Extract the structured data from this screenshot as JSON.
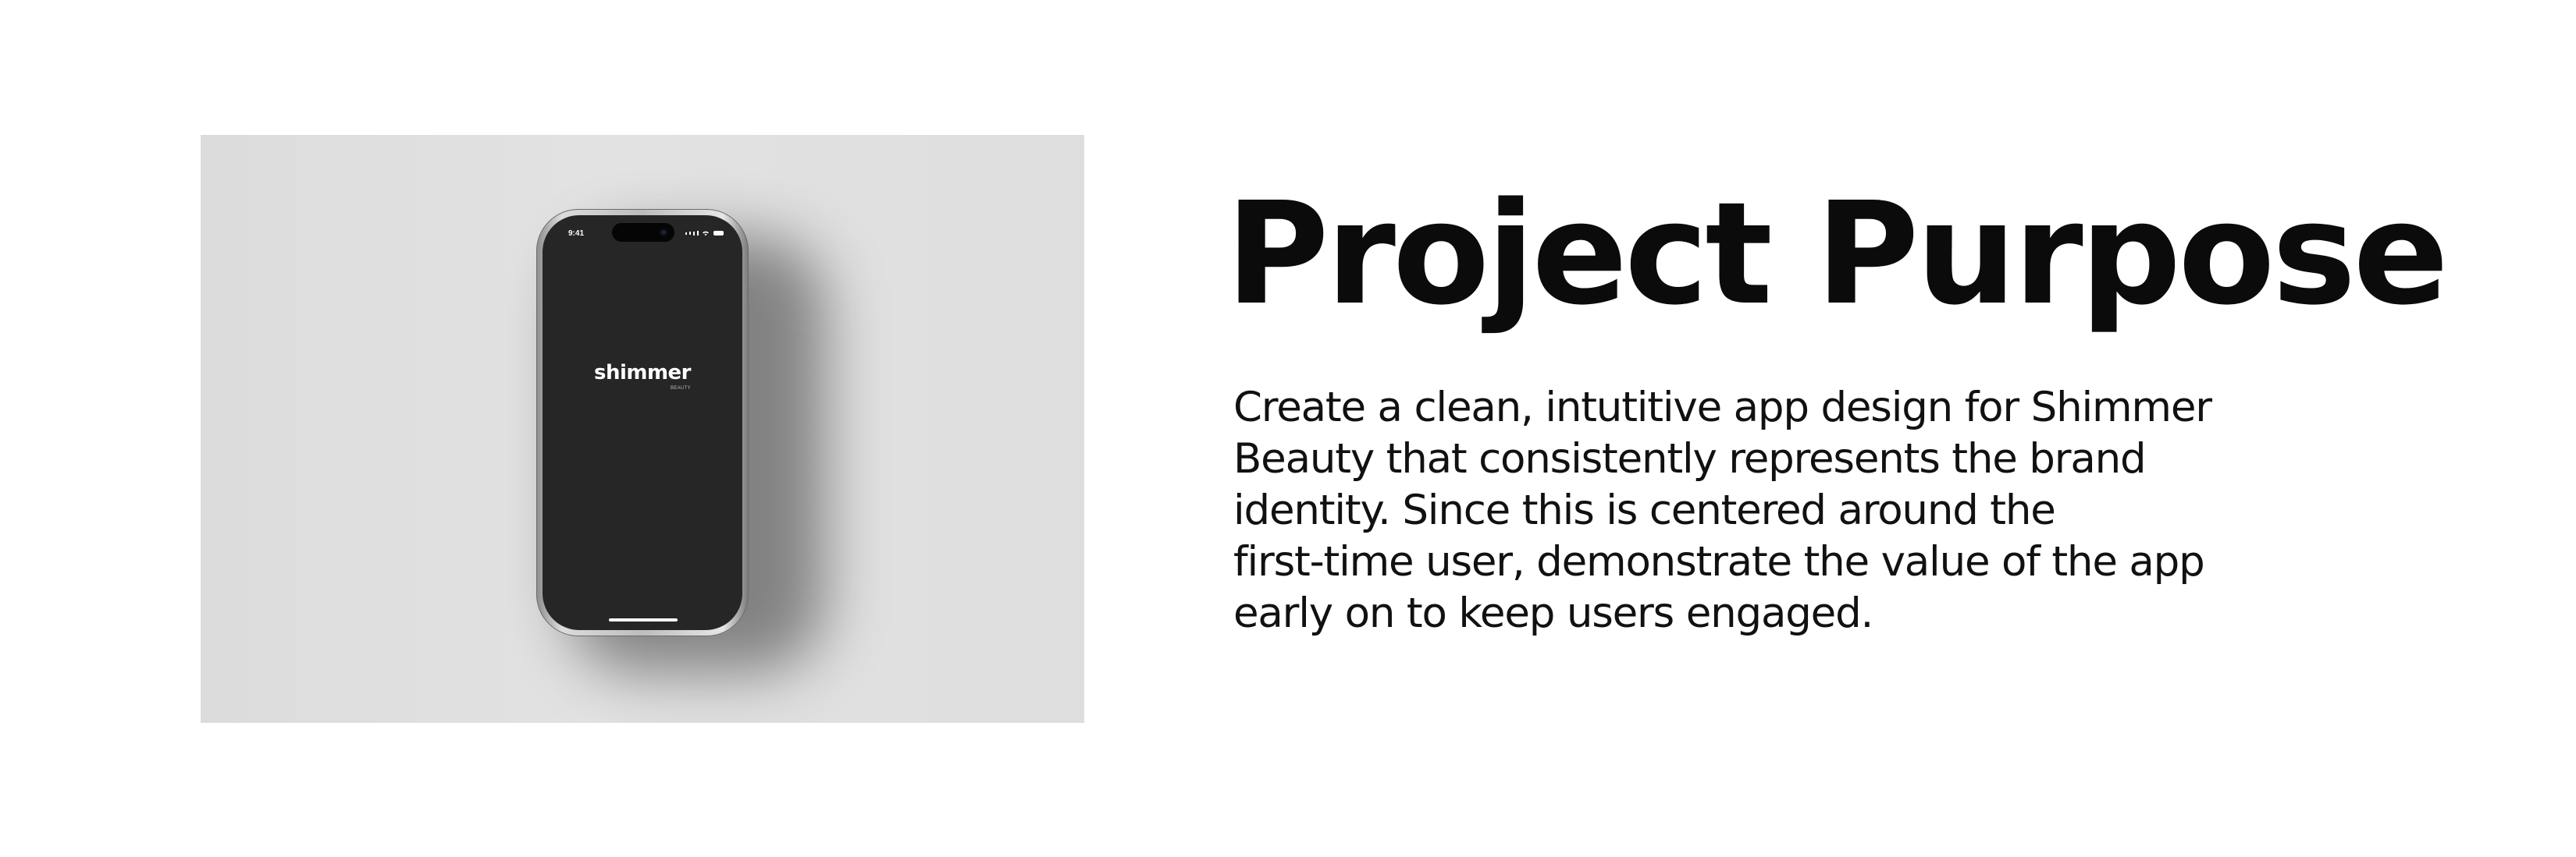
{
  "heading": "Project Purpose",
  "description_lines": [
    "Create a clean, intutitive app design for Shimmer",
    "Beauty that consistently represents the brand",
    "identity. Since this is centered around the",
    "first-time user, demonstrate the value of the app",
    "early on to keep users engaged."
  ],
  "phone": {
    "status_time": "9:41",
    "brand_name": "shimmer",
    "brand_sub": "BEAUTY",
    "screen_color": "#262626",
    "background_color": "#dfdfdf",
    "status_icons": [
      "cellular-signal-icon",
      "wifi-icon",
      "battery-icon"
    ]
  }
}
